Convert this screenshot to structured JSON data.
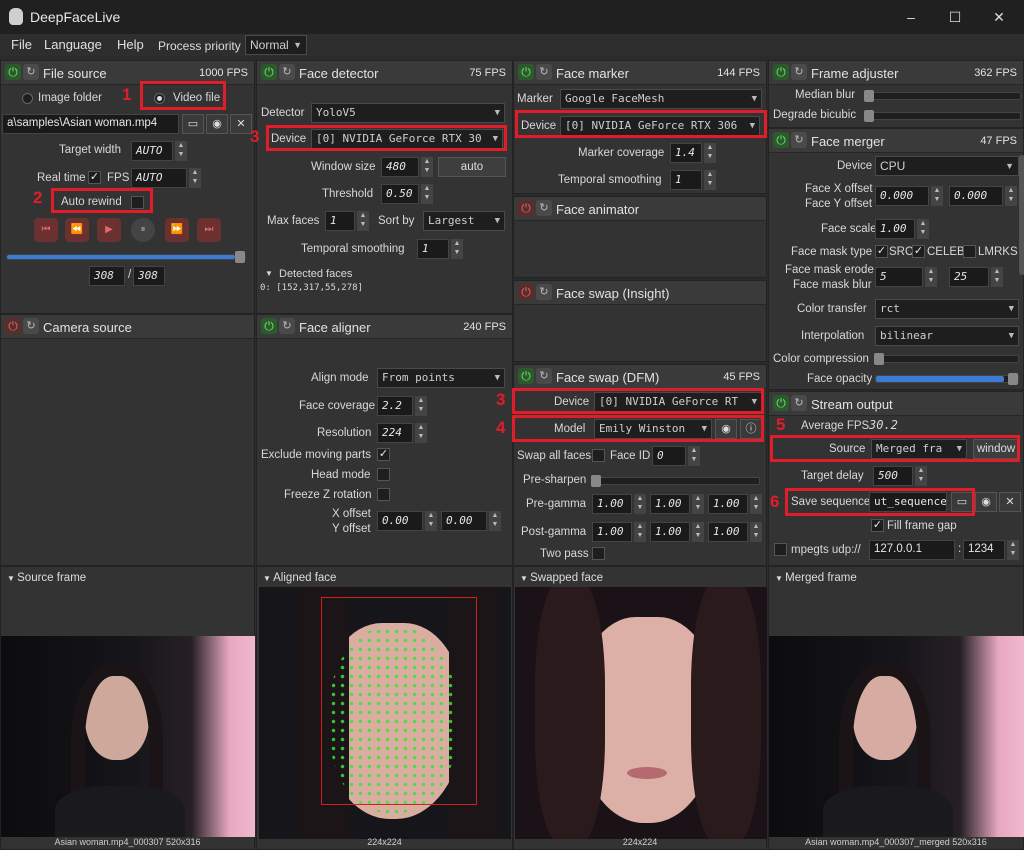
{
  "window": {
    "title": "DeepFaceLive",
    "minimize": "–",
    "maximize": "☐",
    "close": "✕"
  },
  "menu": {
    "file": "File",
    "language": "Language",
    "help": "Help",
    "priority_label": "Process priority",
    "priority_value": "Normal"
  },
  "file_source": {
    "title": "File source",
    "fps": "1000 FPS",
    "image_folder": "Image folder",
    "video_file": "Video file",
    "path": "a\\samples\\Asian woman.mp4",
    "target_width_label": "Target width",
    "target_width": "AUTO",
    "realtime_label": "Real time",
    "fps_label": "FPS",
    "fps_value": "AUTO",
    "auto_rewind": "Auto rewind",
    "frame_current": "308",
    "frame_sep": "/",
    "frame_total": "308",
    "progress": 1.0
  },
  "camera_source": {
    "title": "Camera source"
  },
  "face_detector": {
    "title": "Face detector",
    "fps": "75 FPS",
    "detector_label": "Detector",
    "detector": "YoloV5",
    "device_label": "Device",
    "device": "[0] NVIDIA GeForce RTX 30",
    "window_size_label": "Window size",
    "window_size": "480",
    "auto": "auto",
    "threshold_label": "Threshold",
    "threshold": "0.50",
    "max_faces_label": "Max faces",
    "max_faces": "1",
    "sort_by_label": "Sort by",
    "sort_by": "Largest",
    "temporal_label": "Temporal smoothing",
    "temporal": "1",
    "detected_label": "Detected faces",
    "detected_value": "0: [152,317,55,278]"
  },
  "face_aligner": {
    "title": "Face aligner",
    "fps": "240 FPS",
    "align_mode_label": "Align mode",
    "align_mode": "From points",
    "coverage_label": "Face coverage",
    "coverage": "2.2",
    "resolution_label": "Resolution",
    "resolution": "224",
    "exclude_label": "Exclude moving parts",
    "head_mode_label": "Head mode",
    "freeze_label": "Freeze Z rotation",
    "x_offset_label": "X offset",
    "y_offset_label": "Y offset",
    "x_offset": "0.00",
    "y_offset": "0.00"
  },
  "face_marker": {
    "title": "Face marker",
    "fps": "144 FPS",
    "marker_label": "Marker",
    "marker": "Google FaceMesh",
    "device_label": "Device",
    "device": "[0] NVIDIA GeForce RTX 306",
    "coverage_label": "Marker coverage",
    "coverage": "1.4",
    "temporal_label": "Temporal smoothing",
    "temporal": "1"
  },
  "face_animator": {
    "title": "Face animator"
  },
  "face_swap_insight": {
    "title": "Face swap (Insight)"
  },
  "face_swap_dfm": {
    "title": "Face swap (DFM)",
    "fps": "45 FPS",
    "device_label": "Device",
    "device": "[0] NVIDIA GeForce RT",
    "model_label": "Model",
    "model": "Emily Winston",
    "swap_all_label": "Swap all faces",
    "face_id_label": "Face ID",
    "face_id": "0",
    "presharpen_label": "Pre-sharpen",
    "pregamma_label": "Pre-gamma",
    "postgamma_label": "Post-gamma",
    "gamma": [
      "1.00",
      "1.00",
      "1.00"
    ],
    "two_pass_label": "Two pass"
  },
  "frame_adjuster": {
    "title": "Frame adjuster",
    "fps": "362 FPS",
    "median_label": "Median blur",
    "bicubic_label": "Degrade bicubic"
  },
  "face_merger": {
    "title": "Face merger",
    "fps": "47 FPS",
    "device_label": "Device",
    "device": "CPU",
    "xoff_label": "Face X offset",
    "yoff_label": "Face Y offset",
    "xoff": "0.000",
    "yoff": "0.000",
    "scale_label": "Face scale",
    "scale": "1.00",
    "mask_type_label": "Face mask type",
    "src": "SRC",
    "celeb": "CELEB",
    "lmrks": "LMRKS",
    "erode_label": "Face mask erode",
    "blur_label": "Face mask blur",
    "erode": "5",
    "blur": "25",
    "color_transfer_label": "Color transfer",
    "color_transfer": "rct",
    "interp_label": "Interpolation",
    "interp": "bilinear",
    "compression_label": "Color compression",
    "opacity_label": "Face opacity"
  },
  "stream_output": {
    "title": "Stream output",
    "avg_fps_label": "Average FPS",
    "avg_fps": "30.2",
    "source_label": "Source",
    "source": "Merged fra",
    "window": "window",
    "delay_label": "Target delay",
    "delay": "500",
    "save_label": "Save sequence",
    "save_path": "ut_sequence",
    "fill_gap_label": "Fill frame gap",
    "mpegts_label": "mpegts udp://",
    "ip": "127.0.0.1",
    "port": "1234"
  },
  "viewers": {
    "source_frame": "Source frame",
    "source_caption": "Asian woman.mp4_000307 520x316",
    "aligned_face": "Aligned face",
    "aligned_caption": "224x224",
    "swapped_face": "Swapped face",
    "swapped_caption": "224x224",
    "merged_frame": "Merged frame",
    "merged_caption": "Asian woman.mp4_000307_merged 520x316"
  },
  "annotations": [
    "1",
    "2",
    "3",
    "3",
    "4",
    "5",
    "6"
  ],
  "colors": {
    "highlight": "#e11d2a",
    "accent": "#3a7bd5",
    "power_on": "#6fe36f"
  }
}
